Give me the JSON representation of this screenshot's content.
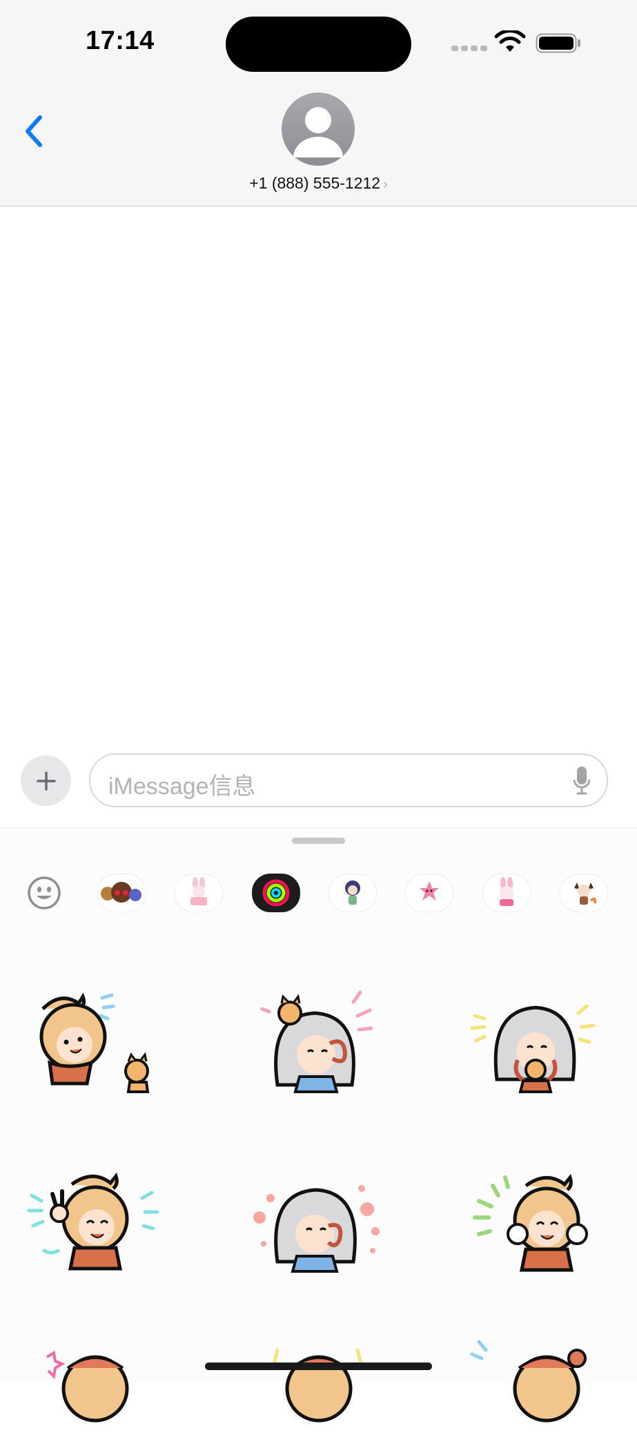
{
  "status_bar": {
    "time": "17:14",
    "icons": [
      "cellular-dots-icon",
      "wifi-icon",
      "battery-icon"
    ]
  },
  "header": {
    "back_icon": "chevron-left-icon",
    "contact_name": "+1 (888) 555-1212",
    "contact_chevron": "›",
    "avatar_icon": "person-icon"
  },
  "composer": {
    "plus_icon": "plus-icon",
    "placeholder": "iMessage信息",
    "mic_icon": "microphone-icon"
  },
  "sticker_drawer": {
    "app_strip": [
      {
        "name": "emoji-icon",
        "active": false
      },
      {
        "name": "memoji-icon",
        "active": false
      },
      {
        "name": "bunny-cake-sticker-app-icon",
        "active": false
      },
      {
        "name": "activity-rings-icon",
        "active": true
      },
      {
        "name": "anime-girl-sticker-app-icon",
        "active": false
      },
      {
        "name": "pink-creature-sticker-app-icon",
        "active": false
      },
      {
        "name": "pink-bunny-sticker-app-icon",
        "active": false
      },
      {
        "name": "fox-girl-sticker-app-icon",
        "active": false
      }
    ],
    "stickers": [
      "blonde-girl-with-cat-sticker",
      "gray-hair-girl-with-cat-sticker",
      "gray-hair-girl-hugging-cat-sticker",
      "blonde-girl-peace-sign-sticker",
      "gray-hair-girl-waving-sticker",
      "blonde-girl-laughing-sticker",
      "blonde-girl-partial-sticker",
      "blonde-girl-partial-sticker",
      "blonde-girl-partial-sticker"
    ]
  },
  "colors": {
    "accent": "#0a7aff",
    "header_bg": "#f6f6f6",
    "placeholder": "#b3b3b7"
  }
}
